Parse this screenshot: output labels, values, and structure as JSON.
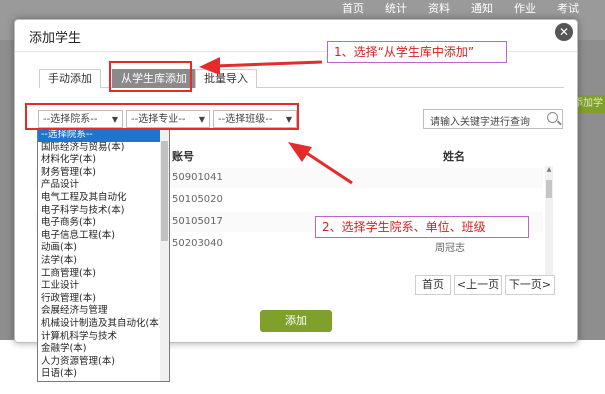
{
  "background": {
    "nav": [
      "首页",
      "统计",
      "资料",
      "通知",
      "作业",
      "考试"
    ],
    "right_button": "添加学"
  },
  "dialog": {
    "title": "添加学生",
    "close_icon": "close-icon",
    "tabs": [
      {
        "label": "手动添加",
        "active": false
      },
      {
        "label": "从学生库添加",
        "active": true
      },
      {
        "label": "批量导入",
        "active": false
      }
    ],
    "filters": {
      "college": "--选择院系--",
      "major": "--选择专业--",
      "class": "--选择班级--"
    },
    "search": {
      "placeholder": "请输入关键字进行查询"
    },
    "table": {
      "columns": [
        "账号",
        "姓名"
      ],
      "rows": [
        {
          "account": "50901041",
          "name": ""
        },
        {
          "account": "50105020",
          "name": ""
        },
        {
          "account": "50105017",
          "name": ""
        },
        {
          "account": "50203040",
          "name": ""
        },
        {
          "account": "",
          "name": "周冠志"
        }
      ]
    },
    "pagination": {
      "first": "首页",
      "prev": "<上一页",
      "next": "下一页>"
    },
    "add_button": "添加",
    "college_options": [
      "--选择院系--",
      "国际经济与贸易(本)",
      "材料化学(本)",
      "财务管理(本)",
      "产品设计",
      "电气工程及其自动化",
      "电子科学与技术(本)",
      "电子商务(本)",
      "电子信息工程(本)",
      "动画(本)",
      "法学(本)",
      "工商管理(本)",
      "工业设计",
      "行政管理(本)",
      "会展经济与管理",
      "机械设计制造及其自动化(本)",
      "计算机科学与技术",
      "金融学(本)",
      "人力资源管理(本)",
      "日语(本)"
    ]
  },
  "annotations": {
    "step1": "1、选择“从学生库中添加”",
    "step2": "2、选择学生院系、单位、班级",
    "color": "#e52b2b"
  }
}
